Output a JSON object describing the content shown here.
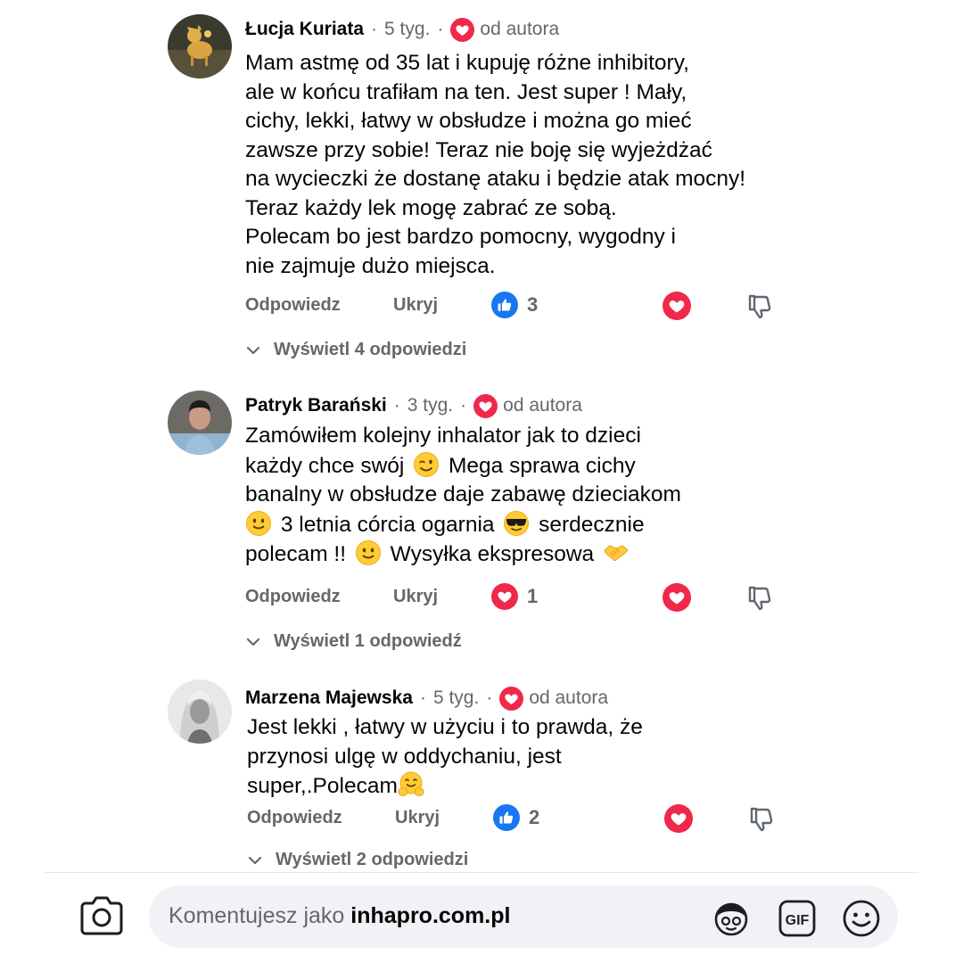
{
  "comments": [
    {
      "author": "Łucja Kuriata",
      "time": "5 tyg.",
      "author_badge": "od autora",
      "lines": [
        "Mam astmę od 35 lat i kupuję różne inhibitory,",
        "ale w końcu trafiłam na ten. Jest super ! Mały,",
        "cichy, lekki, łatwy w obsłudze i można go mieć",
        "zawsze przy sobie! Teraz nie boję się wyjeżdżać",
        "na wycieczki że dostanę ataku i będzie atak mocny!",
        "Teraz każdy lek mogę zabrać ze sobą.",
        "Polecam bo jest bardzo pomocny, wygodny i",
        "nie zajmuje dużo miejsca."
      ],
      "reply_label": "Odpowiedz",
      "hide_label": "Ukryj",
      "reaction_type": "like",
      "reaction_count": "3",
      "replies_label": "Wyświetl 4 odpowiedzi"
    },
    {
      "author": "Patryk Barański",
      "time": "3 tyg.",
      "author_badge": "od autora",
      "segments": {
        "l1": "Zamówiłem kolejny inhalator jak to dzieci",
        "l2a": "każdy chce swój",
        "l2b": "Mega sprawa cichy",
        "l3": "banalny w obsłudze daje zabawę dzieciakom",
        "l4a": "3 letnia córcia ogarnia",
        "l4b": "serdecznie",
        "l5a": "polecam !!",
        "l5b": "Wysyłka ekspresowa"
      },
      "emojis": [
        "winking-face",
        "slightly-smiling-face",
        "smiling-face-with-sunglasses",
        "slightly-smiling-face",
        "handshake"
      ],
      "reply_label": "Odpowiedz",
      "hide_label": "Ukryj",
      "reaction_type": "love",
      "reaction_count": "1",
      "replies_label": "Wyświetl 1 odpowiedź"
    },
    {
      "author": "Marzena Majewska",
      "time": "5 tyg.",
      "author_badge": "od autora",
      "segments": {
        "l1": "Jest lekki , łatwy w użyciu i to prawda, że",
        "l2": "przynosi ulgę w oddychaniu, jest",
        "l3": "super,.Polecam"
      },
      "emojis": [
        "hugging-face"
      ],
      "reply_label": "Odpowiedz",
      "hide_label": "Ukryj",
      "reaction_type": "like",
      "reaction_count": "2",
      "replies_label": "Wyświetl 2 odpowiedzi"
    }
  ],
  "composer": {
    "prefix": "Komentujesz jako",
    "account": "inhapro.com.pl",
    "icons": [
      "camera-icon",
      "avatar-sticker-icon",
      "gif-icon",
      "emoji-icon"
    ]
  },
  "colors": {
    "like_blue": "#1877f2",
    "love_red": "#f02849",
    "secondary_text": "#65676b",
    "primary_text": "#050505",
    "composer_bg": "#f0f2f5"
  }
}
